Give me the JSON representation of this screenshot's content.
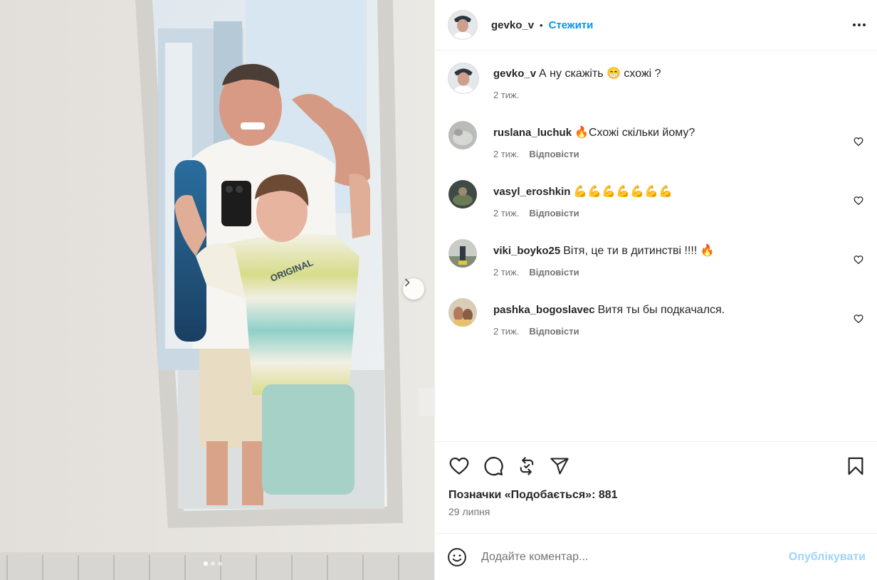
{
  "post": {
    "author": "gevko_v",
    "separator": "•",
    "follow_label": "Стежити",
    "caption": "А ну скажіть 😁 схожі ?",
    "caption_time": "2 тиж."
  },
  "comments": [
    {
      "user": "ruslana_luchuk",
      "text": "🔥Схожі скільки йому?",
      "time": "2 тиж.",
      "reply": "Відповісти"
    },
    {
      "user": "vasyl_eroshkin",
      "text": "💪💪💪💪💪💪💪",
      "time": "2 тиж.",
      "reply": "Відповісти"
    },
    {
      "user": "viki_boyko25",
      "text": "Вітя, це ти в дитинстві !!!! 🔥",
      "time": "2 тиж.",
      "reply": "Відповісти"
    },
    {
      "user": "pashka_bogoslavec",
      "text": "Витя ты бы подкачался.",
      "time": "2 тиж.",
      "reply": "Відповісти"
    }
  ],
  "actions": {
    "icons": [
      "heart-icon",
      "comment-icon",
      "repost-icon",
      "share-icon",
      "bookmark-icon"
    ],
    "likes": "Позначки «Подобається»: 881",
    "date": "29 липня"
  },
  "composer": {
    "placeholder": "Додайте коментар...",
    "publish_label": "Опублікувати"
  },
  "carousel": {
    "slides": 3,
    "active": 1
  },
  "colors": {
    "link_blue": "#0095f6",
    "publish_disabled": "#9fd3fb",
    "muted_text": "#737373",
    "divider": "#efefef"
  }
}
